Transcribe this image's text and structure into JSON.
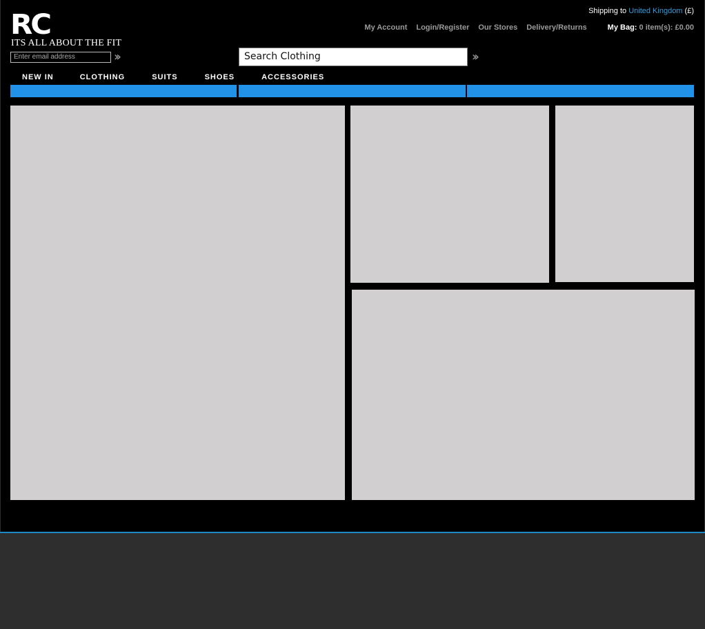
{
  "logo": {
    "mark": "RC",
    "tagline": "ITS ALL ABOUT THE FIT"
  },
  "shipping": {
    "prefix": "Shipping to",
    "country": "United Kingdom",
    "currency": "(£)"
  },
  "account_nav": [
    {
      "label": "My Account"
    },
    {
      "label": "Login/Register"
    },
    {
      "label": "Our Stores"
    },
    {
      "label": "Delivery/Returns"
    }
  ],
  "bag": {
    "label": "My Bag:",
    "summary": "0 item(s): £0.00"
  },
  "newsletter": {
    "placeholder": "Enter email address",
    "submit_icon": "double-chevron-right-icon"
  },
  "search": {
    "placeholder": "Search Clothing",
    "submit_icon": "double-chevron-right-icon"
  },
  "main_nav": [
    {
      "label": "NEW IN"
    },
    {
      "label": "CLOTHING"
    },
    {
      "label": "SUITS"
    },
    {
      "label": "SHOES"
    },
    {
      "label": "ACCESSORIES"
    }
  ],
  "colors": {
    "page_background": "#000000",
    "promo_bar": "#2291e8",
    "content_panel": "#d1cfd0",
    "link_accent": "#2b9fe0",
    "footer_background": "#2e2e2e"
  }
}
